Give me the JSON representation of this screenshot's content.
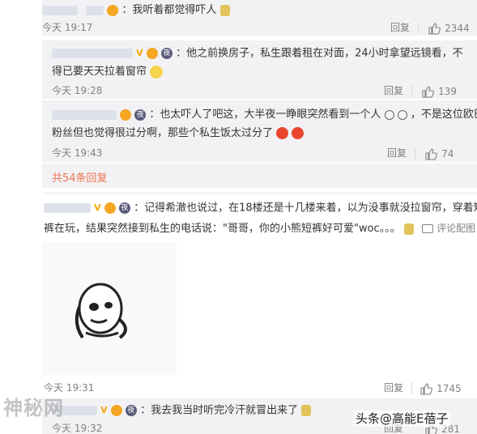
{
  "comments": [
    {
      "text": "：我听着都觉得吓人",
      "time": "今天 19:17",
      "reply_label": "回复",
      "likes": "2344"
    },
    {
      "text_line1": "：他之前换房子，私生跟着租在对面，24小时拿望远镜看，不",
      "text_line2": "得已要天天拉着窗帘",
      "time": "今天 19:28",
      "reply_label": "回复",
      "likes": "139"
    },
    {
      "text_line1": "：也太吓人了吧这，大半夜一睁眼突然看到一个人",
      "text_line1b": "，不是这位欧巴",
      "text_line2": "粉丝但也觉得很过分啊，那些个私生饭太过分了",
      "time": "今天 19:43",
      "reply_label": "回复",
      "likes": "74"
    },
    {
      "more_replies": "共54条回复"
    },
    {
      "text_line1": "：记得希澈也说过，在18楼还是十几楼来着，以为没事就没拉窗帘，穿着短",
      "text_line2": "裤在玩，结果突然接到私生的电话说：\"哥哥，你的小熊短裤好可爱\"woc。。。",
      "review_image_label": "评论配图",
      "time": "今天 19:31",
      "reply_label": "回复",
      "likes": "1745"
    },
    {
      "text": "：我去我当时听完冷汗就冒出来了",
      "time": "今天 19:32",
      "reply_label": "回复",
      "likes": "281"
    }
  ],
  "watermark_left": "神秘网",
  "watermark_right": "头条@高能E蓓子",
  "icons": {
    "like": "thumbs-up-icon",
    "image": "image-icon",
    "vip": "vip-badge-icon",
    "night": "night-badge-icon",
    "emoji": "emoji-icon"
  },
  "colors": {
    "username": "#eb7350",
    "link": "#eb7350",
    "meta": "#808080",
    "reply_bg": "#f2f2f5"
  }
}
